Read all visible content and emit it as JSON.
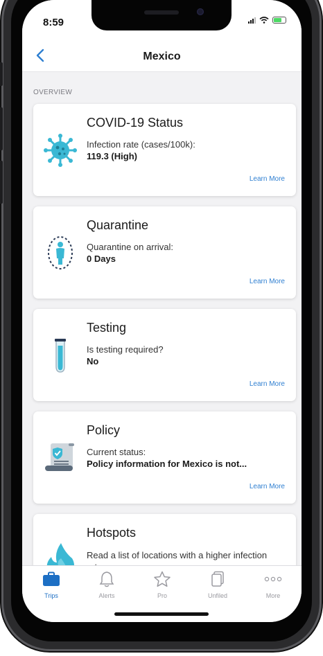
{
  "status_bar": {
    "time": "8:59"
  },
  "nav": {
    "title": "Mexico"
  },
  "section_label": "OVERVIEW",
  "cards": [
    {
      "title": "COVID-19 Status",
      "label": "Infection rate (cases/100k):",
      "value": "119.3 (High)",
      "link": "Learn More",
      "icon": "virus-icon"
    },
    {
      "title": "Quarantine",
      "label": "Quarantine on arrival:",
      "value": "0 Days",
      "link": "Learn More",
      "icon": "person-quarantine-icon"
    },
    {
      "title": "Testing",
      "label": "Is testing required?",
      "value": "No",
      "link": "Learn More",
      "icon": "test-tube-icon"
    },
    {
      "title": "Policy",
      "label": "Current status:",
      "value": "Policy information for Mexico is not...",
      "link": "Learn More",
      "icon": "policy-document-icon"
    },
    {
      "title": "Hotspots",
      "label": "Read a list of locations with a higher infection rate",
      "icon": "flame-icon"
    }
  ],
  "tabs": [
    {
      "label": "Trips",
      "icon": "briefcase-icon",
      "active": true
    },
    {
      "label": "Alerts",
      "icon": "bell-icon"
    },
    {
      "label": "Pro",
      "icon": "star-icon"
    },
    {
      "label": "Unfiled",
      "icon": "documents-icon"
    },
    {
      "label": "More",
      "icon": "more-dots-icon"
    }
  ],
  "colors": {
    "accent": "#2f7fd1",
    "icon_teal": "#3ab8d4",
    "active_tab": "#1d6fc4",
    "background": "#f2f2f4"
  }
}
